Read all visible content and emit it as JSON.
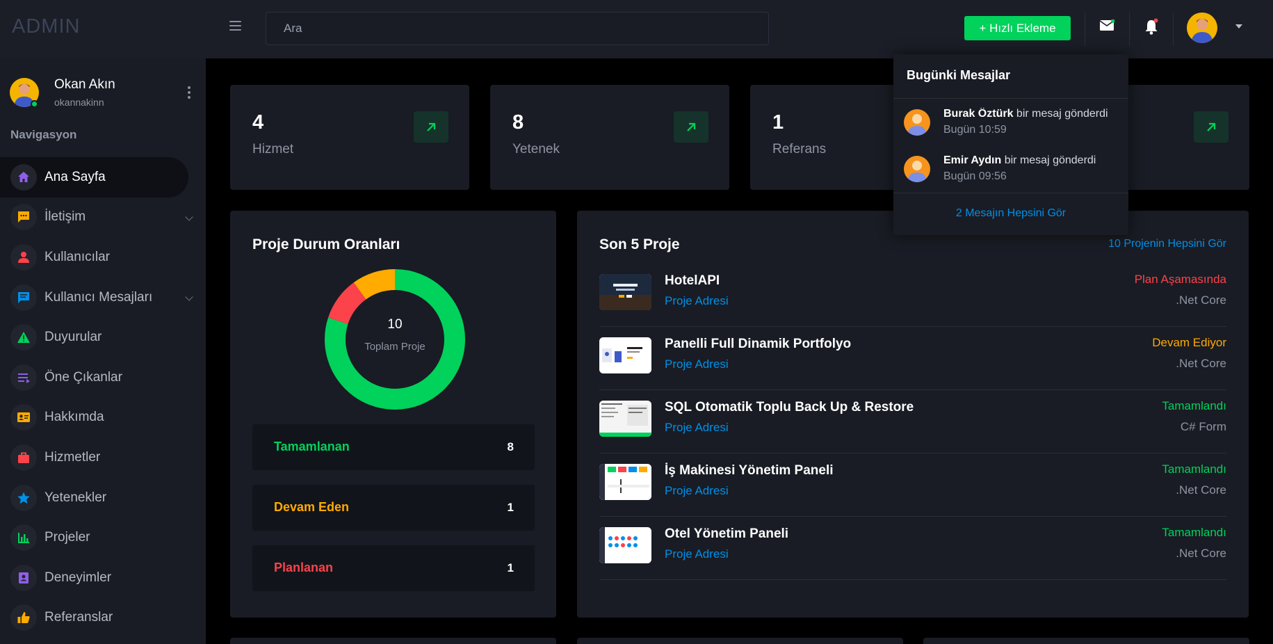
{
  "brand": "ADMIN",
  "search": {
    "placeholder": "Ara"
  },
  "header": {
    "quick_add_label": "+ Hızlı Ekleme",
    "icons": [
      "menu-icon",
      "mail-icon",
      "bell-icon",
      "chevron-down-icon"
    ]
  },
  "profile": {
    "name": "Okan Akın",
    "username": "okannakinn"
  },
  "sidebar": {
    "heading": "Navigasyon",
    "items": [
      {
        "label": "Ana Sayfa",
        "icon": "home-icon",
        "color": "#8f5fe8"
      },
      {
        "label": "İletişim",
        "icon": "chat-icon",
        "color": "#ffab00"
      },
      {
        "label": "Kullanıcılar",
        "icon": "user-icon",
        "color": "#fc424a"
      },
      {
        "label": "Kullanıcı Mesajları",
        "icon": "message-icon",
        "color": "#0090e7"
      },
      {
        "label": "Duyurular",
        "icon": "alert-icon",
        "color": "#00d25b"
      },
      {
        "label": "Öne Çıkanlar",
        "icon": "list-icon",
        "color": "#8f5fe8"
      },
      {
        "label": "Hakkımda",
        "icon": "id-card-icon",
        "color": "#ffab00"
      },
      {
        "label": "Hizmetler",
        "icon": "briefcase-icon",
        "color": "#fc424a"
      },
      {
        "label": "Yetenekler",
        "icon": "star-icon",
        "color": "#0090e7"
      },
      {
        "label": "Projeler",
        "icon": "chart-icon",
        "color": "#00d25b"
      },
      {
        "label": "Deneyimler",
        "icon": "contact-icon",
        "color": "#8f5fe8"
      },
      {
        "label": "Referanslar",
        "icon": "thumbs-up-icon",
        "color": "#ffab00"
      }
    ]
  },
  "stats": [
    {
      "value": "4",
      "label": "Hizmet"
    },
    {
      "value": "8",
      "label": "Yetenek"
    },
    {
      "value": "1",
      "label": "Referans"
    },
    {
      "value": "",
      "label": ""
    }
  ],
  "status_panel": {
    "title": "Proje Durum Oranları",
    "total": "10",
    "total_caption": "Toplam Proje",
    "rows": [
      {
        "label": "Tamamlanan",
        "count": "8",
        "color": "#00d25b"
      },
      {
        "label": "Devam Eden",
        "count": "1",
        "color": "#ffab00"
      },
      {
        "label": "Planlanan",
        "count": "1",
        "color": "#fc424a"
      }
    ]
  },
  "projects_panel": {
    "title": "Son 5 Proje",
    "see_all": "10 Projenin Hepsini Gör",
    "items": [
      {
        "name": "HotelAPI",
        "link": "Proje Adresi",
        "status": "Plan Aşamasında",
        "status_color": "#fc424a",
        "tech": ".Net Core"
      },
      {
        "name": "Panelli Full Dinamik Portfolyo",
        "link": "Proje Adresi",
        "status": "Devam Ediyor",
        "status_color": "#ffab00",
        "tech": ".Net Core"
      },
      {
        "name": "SQL Otomatik Toplu Back Up & Restore",
        "link": "Proje Adresi",
        "status": "Tamamlandı",
        "status_color": "#00d25b",
        "tech": "C# Form"
      },
      {
        "name": "İş Makinesi Yönetim Paneli",
        "link": "Proje Adresi",
        "status": "Tamamlandı",
        "status_color": "#00d25b",
        "tech": ".Net Core"
      },
      {
        "name": "Otel Yönetim Paneli",
        "link": "Proje Adresi",
        "status": "Tamamlandı",
        "status_color": "#00d25b",
        "tech": ".Net Core"
      }
    ]
  },
  "messages_dropdown": {
    "title": "Bugünki Mesajlar",
    "items": [
      {
        "sender": "Burak Öztürk",
        "text": " bir mesaj gönderdi",
        "time": "Bugün 10:59"
      },
      {
        "sender": "Emir Aydın",
        "text": " bir mesaj gönderdi",
        "time": "Bugün 09:56"
      }
    ],
    "see_all": "2 Mesajın Hepsini Gör"
  },
  "colors": {
    "accent_green": "#00d25b",
    "accent_blue": "#0090e7",
    "warning": "#ffab00",
    "danger": "#fc424a",
    "panel": "#191c24"
  }
}
